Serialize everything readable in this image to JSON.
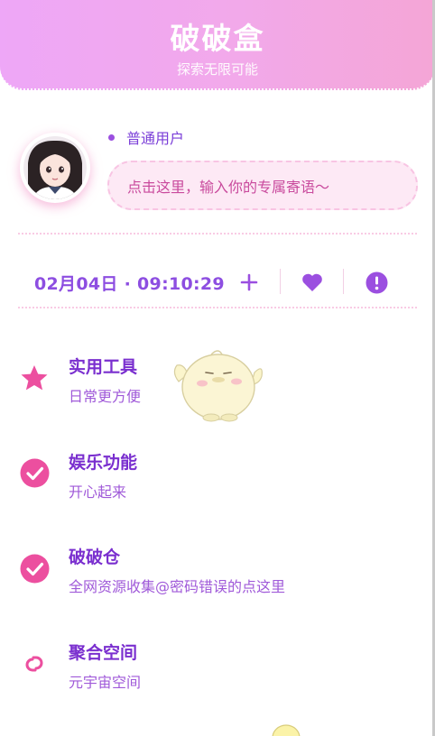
{
  "header": {
    "title": "破破盒",
    "subtitle": "探索无限可能"
  },
  "profile": {
    "user_type": "普通用户",
    "motto_placeholder": "点击这里，输入你的专属寄语～"
  },
  "status": {
    "datetime": "02月04日 · 09:10:29"
  },
  "actions": [
    {
      "icon": "plus-icon"
    },
    {
      "icon": "heart-icon"
    },
    {
      "icon": "exclamation-circle-icon"
    }
  ],
  "menu": [
    {
      "icon": "star-icon",
      "title": "实用工具",
      "subtitle": "日常更方便"
    },
    {
      "icon": "check-circle-icon",
      "title": "娱乐功能",
      "subtitle": "开心起来"
    },
    {
      "icon": "check-circle-icon",
      "title": "破破仓",
      "subtitle": "全网资源收集@密码错误的点这里"
    },
    {
      "icon": "link-icon",
      "title": "聚合空间",
      "subtitle": "元宇宙空间"
    }
  ],
  "colors": {
    "header_gradient_start": "#eea7f7",
    "header_gradient_end": "#f4a6d6",
    "primary_purple": "#8d4ee1",
    "accent_pink": "#ec4f9f"
  }
}
